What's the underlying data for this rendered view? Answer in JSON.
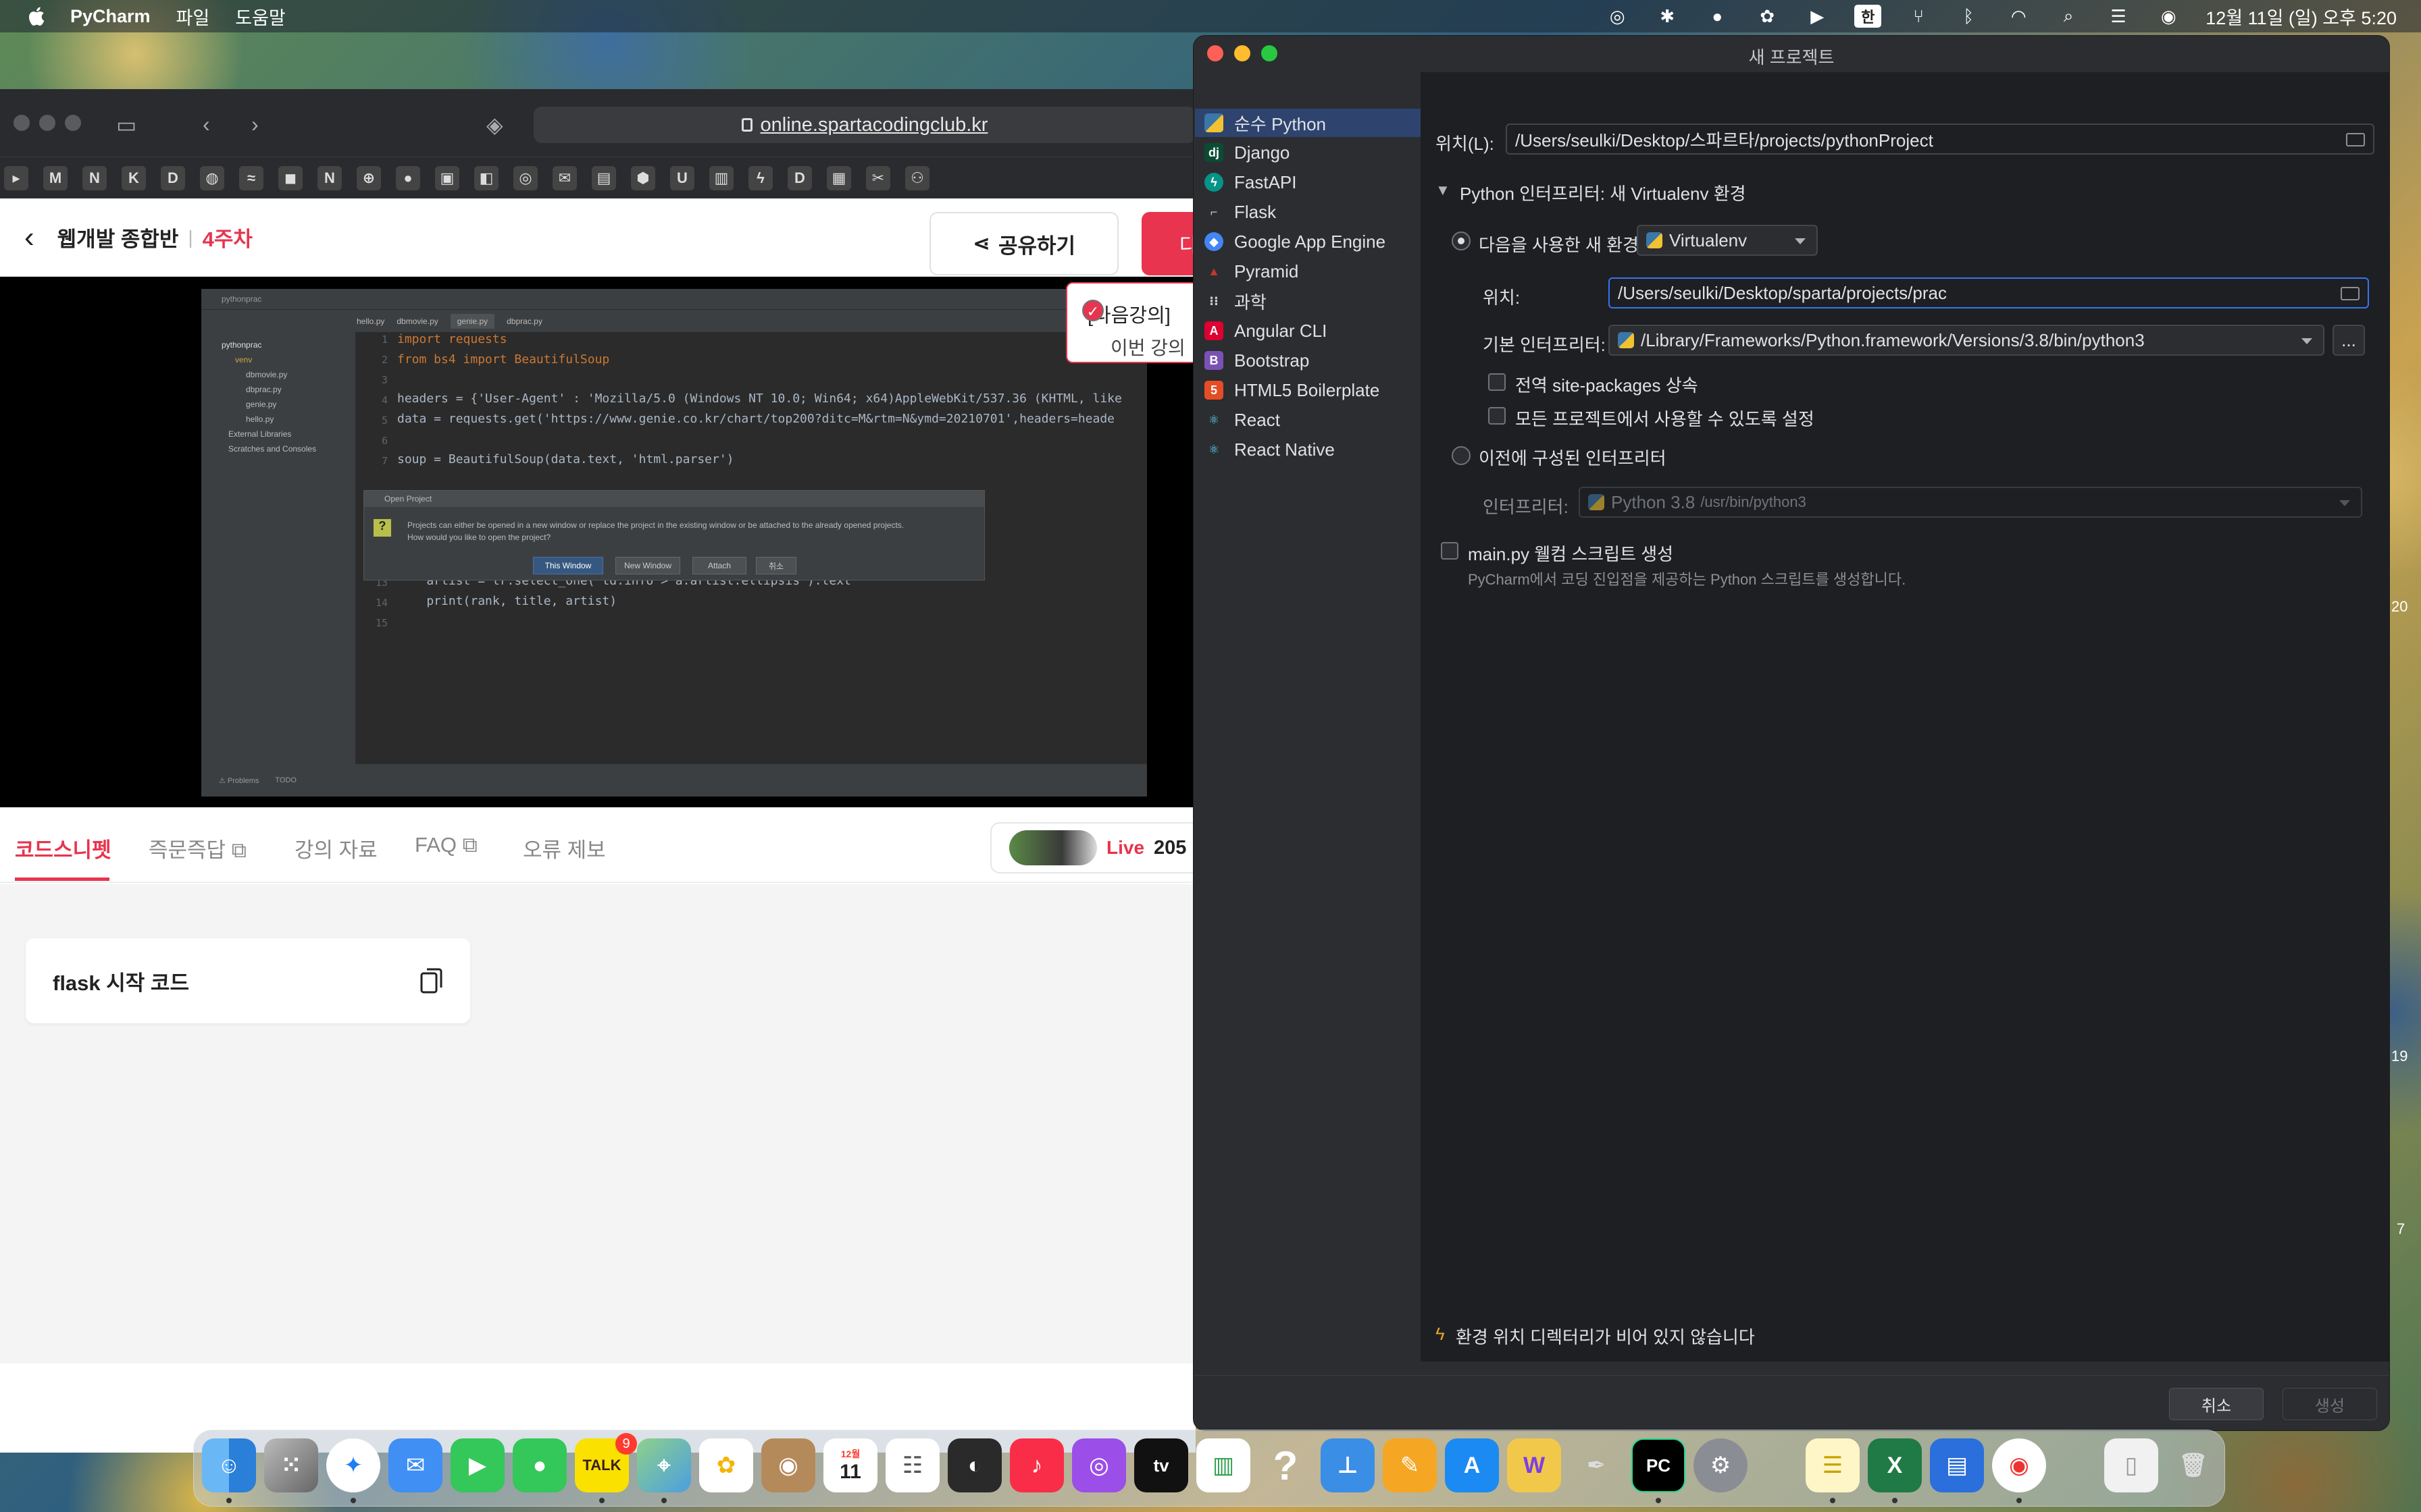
{
  "menubar": {
    "app": "PyCharm",
    "menus": [
      "파일",
      "도움말"
    ],
    "input_source": "한",
    "datetime": "12월 11일 (일) 오후 5:20"
  },
  "browser": {
    "url": "online.spartacodingclub.kr",
    "bookmarks": [
      "M",
      "N",
      "K",
      "D",
      "N",
      "U",
      "D"
    ],
    "course_title": "웹개발 종합반",
    "week": "4주차",
    "share_label": "공유하기",
    "next_label": "다",
    "toast_title": "[다음강의]",
    "toast_text": "이번 강의",
    "tabs": [
      "코드스니펫",
      "즉문즉답",
      "강의 자료",
      "FAQ",
      "오류 제보"
    ],
    "live_label": "Live",
    "live_count": "205",
    "snippet_label": "flask 시작 코드"
  },
  "video": {
    "project": "pythonprac",
    "files": [
      "dbmovie.py",
      "dbprac.py",
      "genie.py",
      "hello.py"
    ],
    "tree_extra": [
      "External Libraries",
      "Scratches and Consoles"
    ],
    "code_lines": [
      {
        "n": "1",
        "t": "import requests"
      },
      {
        "n": "2",
        "t": "from bs4 import BeautifulSoup"
      },
      {
        "n": "3",
        "t": ""
      },
      {
        "n": "4",
        "t": "headers = {'User-Agent' : 'Mozilla/5.0 (Windows NT 10.0; Win64; x64)AppleWebKit/537.36 (KHTML, like"
      },
      {
        "n": "5",
        "t": "data = requests.get('https://www.genie.co.kr/chart/top200?ditc=M&rtm=N&ymd=20210701',headers=heade"
      },
      {
        "n": "6",
        "t": ""
      },
      {
        "n": "7",
        "t": "soup = BeautifulSoup(data.text, 'html.parser')"
      },
      {
        "n": "13",
        "t": "    artist = tr.select_one('td.info > a.artist.ellipsis').text"
      },
      {
        "n": "14",
        "t": "    print(rank, title, artist)"
      },
      {
        "n": "15",
        "t": ""
      }
    ],
    "dialog_title": "Open Project",
    "dialog_msg1": "Projects can either be opened in a new window or replace the project in the existing window or be attached to the already opened projects.",
    "dialog_msg2": "How would you like to open the project?",
    "dialog_buttons": [
      "This Window",
      "New Window",
      "Attach",
      "취소"
    ]
  },
  "pycharm": {
    "title": "새 프로젝트",
    "project_types": [
      "순수 Python",
      "Django",
      "FastAPI",
      "Flask",
      "Google App Engine",
      "Pyramid",
      "과학",
      "Angular CLI",
      "Bootstrap",
      "HTML5 Boilerplate",
      "React",
      "React Native"
    ],
    "location_label": "위치(L):",
    "location_value": "/Users/seulki/Desktop/스파르타/projects/pythonProject",
    "interpreter_section": "Python 인터프리터: 새 Virtualenv 환경",
    "new_env_label": "다음을 사용한 새 환경",
    "env_type": "Virtualenv",
    "venv_location_label": "위치:",
    "venv_location_value": "/Users/seulki/Desktop/sparta/projects/prac",
    "base_interp_label": "기본 인터프리터:",
    "base_interp_value": "/Library/Frameworks/Python.framework/Versions/3.8/bin/python3",
    "browse_label": "...",
    "inherit_label": "전역 site-packages 상속",
    "available_label": "모든 프로젝트에서 사용할 수 있도록 설정",
    "existing_label": "이전에 구성된 인터프리터",
    "interp_label": "인터프리터:",
    "interp_value": "Python 3.8",
    "interp_path": "/usr/bin/python3",
    "welcome_label": "main.py 웰컴 스크립트 생성",
    "welcome_desc": "PyCharm에서 코딩 진입점을 제공하는 Python 스크립트를 생성합니다.",
    "warning": "환경 위치 디렉터리가 비어 있지 않습니다",
    "cancel_label": "취소",
    "create_label": "생성"
  },
  "edge_numbers": [
    "20",
    "19",
    "7"
  ],
  "dock": {
    "talk_badge": "9",
    "calendar_month": "12월",
    "calendar_day": "11"
  }
}
